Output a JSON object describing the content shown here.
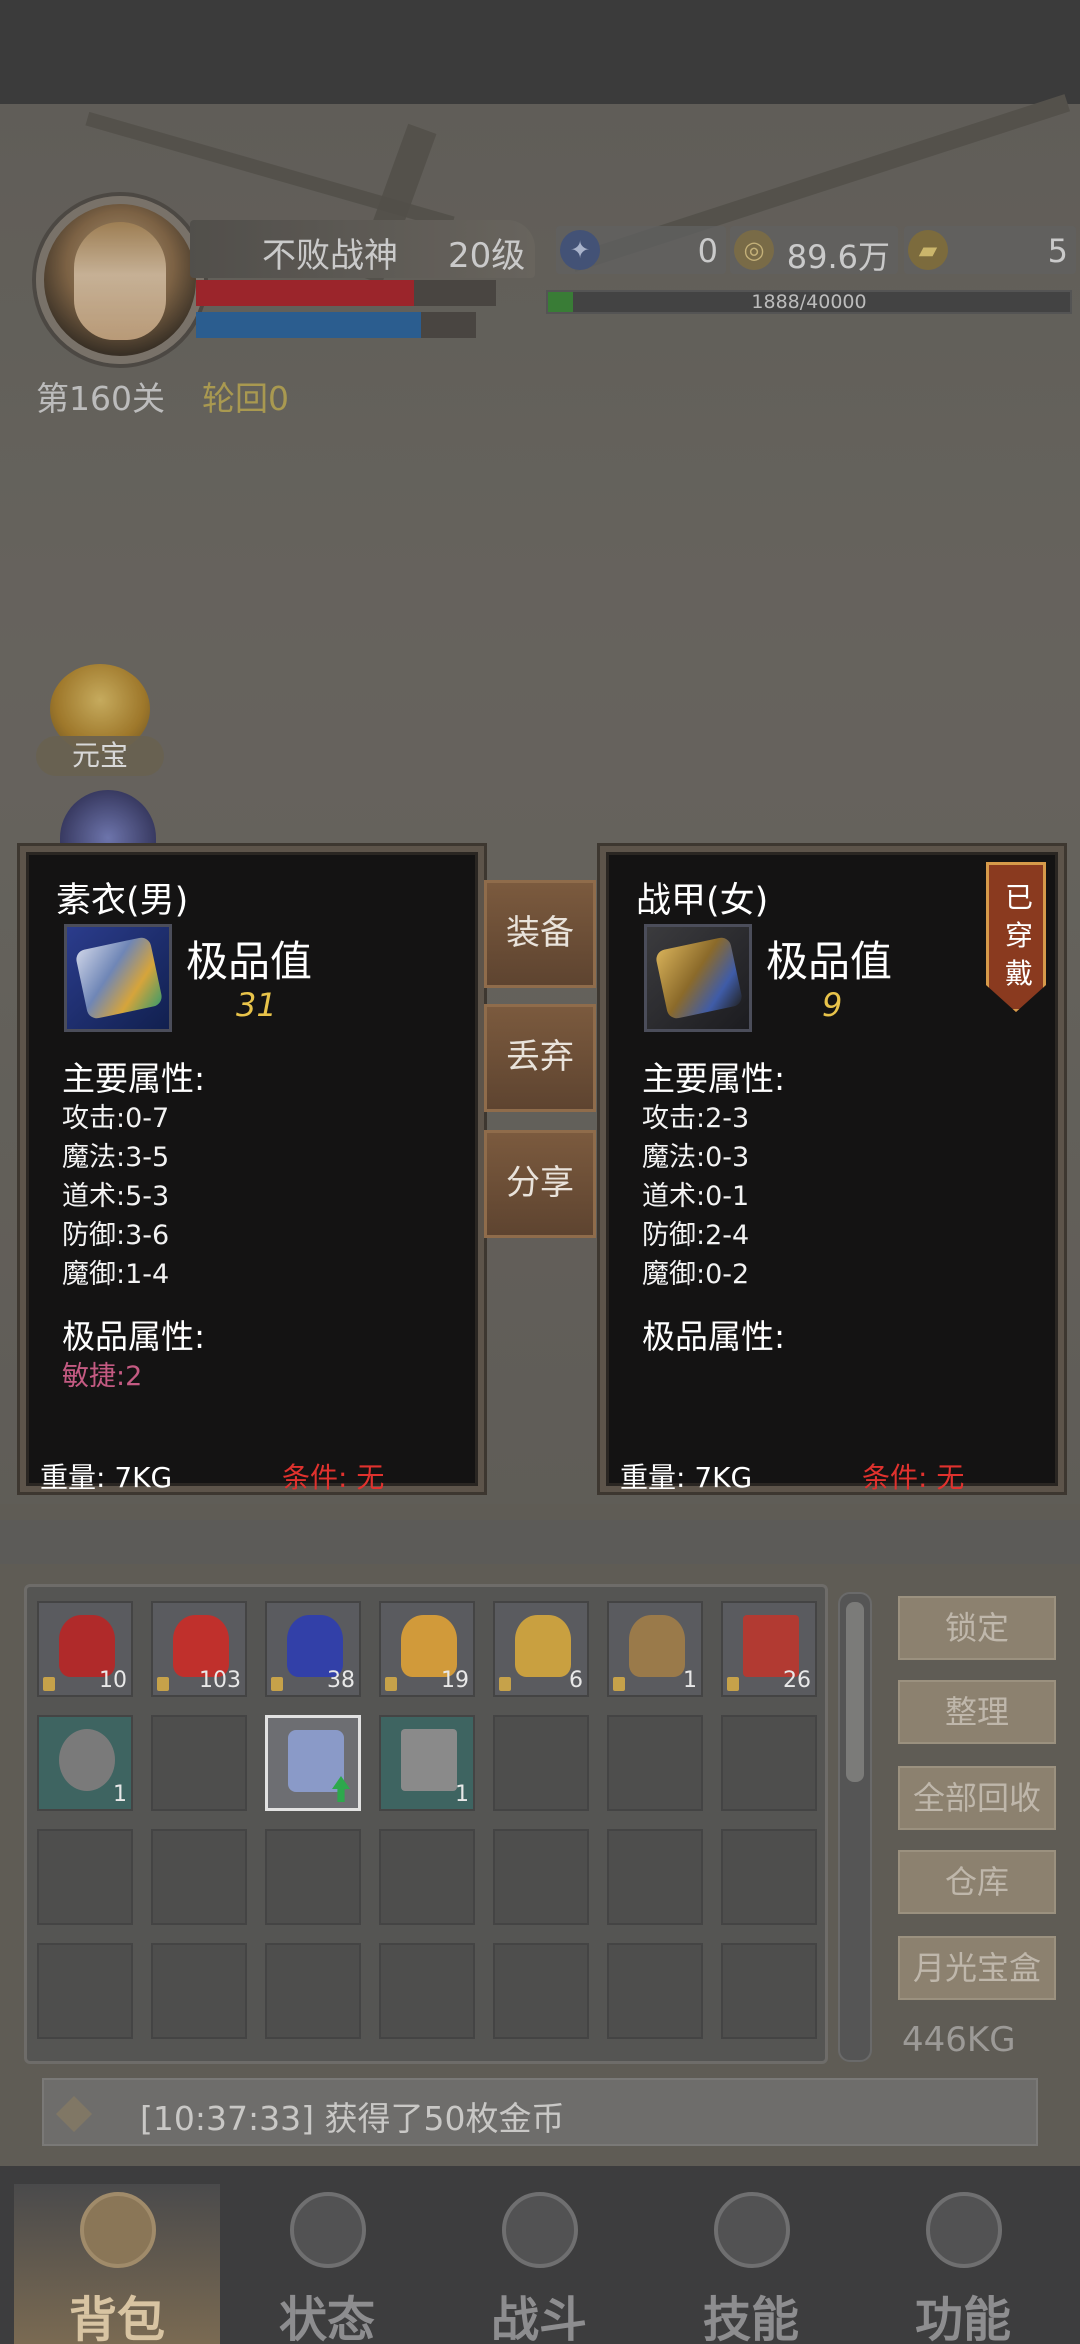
{
  "player": {
    "name": "不败战神",
    "level": "20级",
    "stage": "第160关",
    "rebirth": "轮回0"
  },
  "resources": [
    {
      "icon": "compass-icon",
      "value": "0"
    },
    {
      "icon": "coin-icon",
      "value": "89.6万"
    },
    {
      "icon": "gold-ingot-icon",
      "value": "5"
    }
  ],
  "exp": {
    "text": "1888/40000",
    "progress": 0.0472
  },
  "side_buttons": {
    "yuanbao": "元宝"
  },
  "card_left": {
    "title": "素衣(男)",
    "quality_label": "极品值",
    "quality_value": "31",
    "main_attr_title": "主要属性:",
    "stats": [
      "攻击:0-7",
      "魔法:3-5",
      "道术:5-3",
      "防御:3-6",
      "魔御:1-4"
    ],
    "extra_attr_title": "极品属性:",
    "extra_stats": [
      "敏捷:2"
    ],
    "weight": "重量: 7KG",
    "condition": "条件: 无"
  },
  "card_right": {
    "title": "战甲(女)",
    "quality_label": "极品值",
    "quality_value": "9",
    "main_attr_title": "主要属性:",
    "stats": [
      "攻击:2-3",
      "魔法:0-3",
      "道术:0-1",
      "防御:2-4",
      "魔御:0-2"
    ],
    "extra_attr_title": "极品属性:",
    "weight": "重量: 7KG",
    "condition": "条件: 无",
    "worn_badge": "已穿戴"
  },
  "actions": {
    "equip": "装备",
    "discard": "丢弃",
    "share": "分享"
  },
  "inventory": {
    "items": [
      {
        "icon": "red-potion-small-icon",
        "count": "10",
        "color": "#b02a2a"
      },
      {
        "icon": "red-potion-large-icon",
        "count": "103",
        "color": "#c0302c"
      },
      {
        "icon": "blue-potion-icon",
        "count": "38",
        "color": "#3240a8"
      },
      {
        "icon": "sun-potion-icon",
        "count": "19",
        "color": "#d19a3a"
      },
      {
        "icon": "treasure-bag-icon",
        "count": "6",
        "color": "#c9a040"
      },
      {
        "icon": "ore-icon",
        "count": "1",
        "color": "#9a7a4a"
      },
      {
        "icon": "red-book-icon",
        "count": "26",
        "color": "#b23a32"
      },
      {
        "icon": "necklace-icon",
        "count": "1",
        "color": "#7a7a7a"
      },
      {
        "icon": "empty",
        "count": ""
      },
      {
        "icon": "armor-icon",
        "count": "",
        "color": "#8a9ac8"
      },
      {
        "icon": "hammer-icon",
        "count": "1",
        "color": "#8a8a8a"
      }
    ]
  },
  "menu": {
    "lock": "锁定",
    "sort": "整理",
    "recycle_all": "全部回收",
    "warehouse": "仓库",
    "moonlight_box": "月光宝盒",
    "total_weight": "446KG"
  },
  "message": "[10:37:33] 获得了50枚金币",
  "nav": [
    {
      "label": "背包",
      "icon": "bag-icon",
      "active": true
    },
    {
      "label": "状态",
      "icon": "status-icon",
      "active": false
    },
    {
      "label": "战斗",
      "icon": "battle-icon",
      "active": false
    },
    {
      "label": "技能",
      "icon": "skill-icon",
      "active": false
    },
    {
      "label": "功能",
      "icon": "function-icon",
      "active": false
    }
  ]
}
